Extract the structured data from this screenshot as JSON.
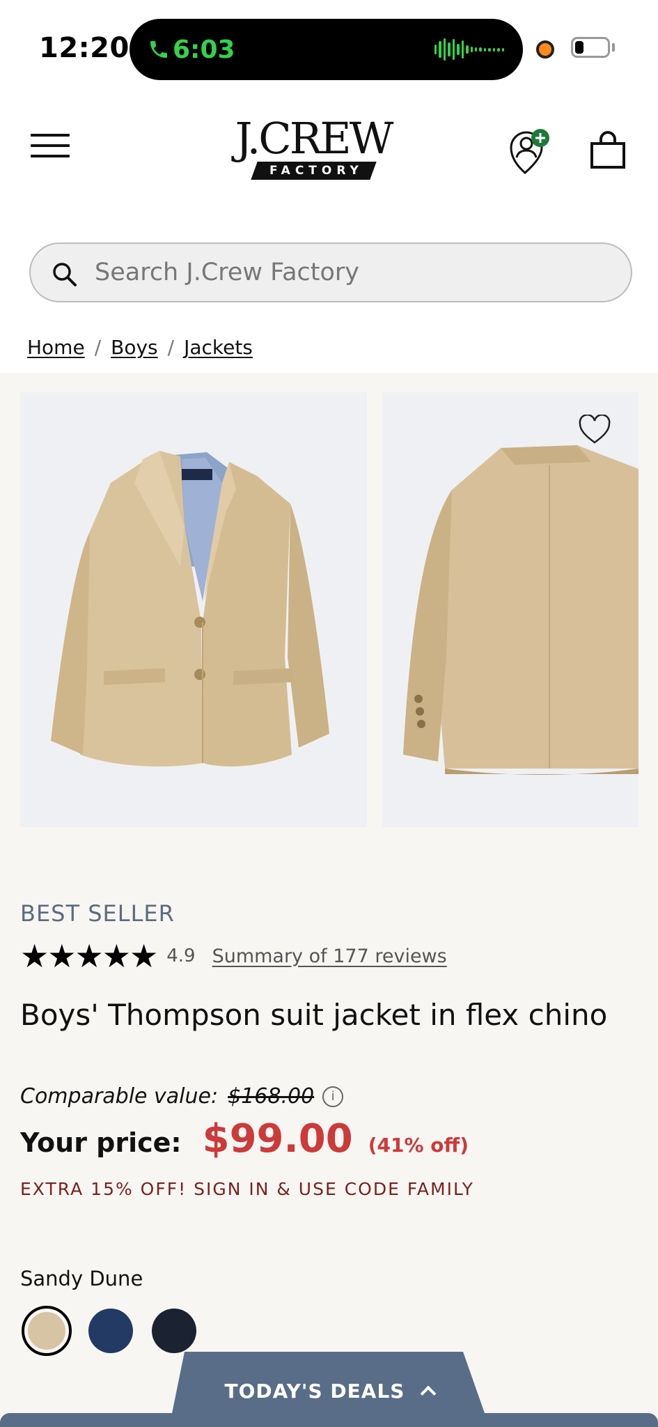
{
  "status": {
    "time": "12:20",
    "call_time": "6:03",
    "icons": [
      "phone-icon",
      "audio-wave-icon",
      "recording-dot-icon",
      "battery-icon"
    ],
    "accent": "#33d24b"
  },
  "header": {
    "logo_main": "J.CREW",
    "logo_sub": "FACTORY",
    "icons": [
      "menu-icon",
      "account-icon",
      "bag-icon"
    ]
  },
  "search": {
    "placeholder": "Search J.Crew Factory"
  },
  "breadcrumb": [
    {
      "label": "Home"
    },
    {
      "label": "Boys"
    },
    {
      "label": "Jackets"
    }
  ],
  "product": {
    "badge": "BEST SELLER",
    "stars": "★★★★★",
    "rating": "4.9",
    "reviews_link": "Summary of 177 reviews",
    "title": "Boys' Thompson suit jacket in flex chino",
    "comparable_label": "Comparable value:",
    "comparable_price": "$168.00",
    "price_label": "Your price:",
    "price": "$99.00",
    "discount": "(41% off)",
    "promo": "EXTRA 15% OFF! SIGN IN & USE CODE FAMILY",
    "color_name": "Sandy Dune",
    "swatches": [
      {
        "color": "#d6c4a4"
      },
      {
        "color": "#223a64"
      },
      {
        "color": "#1b2232"
      }
    ],
    "price_color": "#cc3a3a"
  },
  "deals": {
    "label": "TODAY'S DEALS",
    "color": "#5a6d88"
  }
}
